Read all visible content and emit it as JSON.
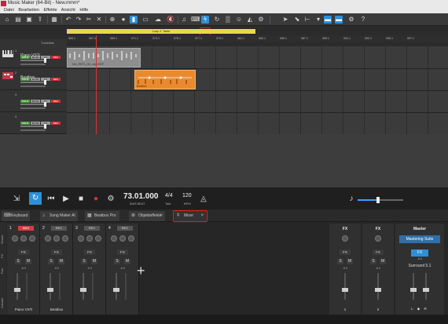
{
  "window": {
    "title": "Music Maker (64-Bit) - New.mmm*"
  },
  "menu": {
    "items": [
      "Datei",
      "Bearbeiten",
      "Effekte",
      "Ansicht",
      "Hilfe"
    ]
  },
  "ruler": {
    "loop_label": "Loop 1 Takte",
    "marks": [
      "065.1",
      "067.1",
      "069.1",
      "071.1",
      "073.1",
      "075.1",
      "077.1",
      "079.1",
      "081.1",
      "083.1",
      "085.1",
      "087.1",
      "089.1",
      "091.1",
      "093.1",
      "095.1",
      "097.1"
    ]
  },
  "tracks_header": {
    "label": "Trackliste"
  },
  "tracks": [
    {
      "num": "1",
      "name": "Piano VSTi",
      "solo": "SOLO",
      "mute": "MUTE",
      "fx": "FX",
      "rec": "REC"
    },
    {
      "num": "2",
      "name": "Beatbox",
      "solo": "SOLO",
      "mute": "MUTE",
      "fx": "FX",
      "rec": "REC"
    },
    {
      "num": "3",
      "name": "",
      "solo": "SOLO",
      "mute": "MUTE",
      "fx": "FX",
      "rec": "REC"
    },
    {
      "num": "4",
      "name": "",
      "solo": "SOLO",
      "mute": "MUTE",
      "fx": "FX",
      "rec": "REC"
    }
  ],
  "clips": {
    "piano_label": "Mio_REF1_Ob_mp3.HDP",
    "beat_label": "Beatbox"
  },
  "transport": {
    "position": "73.01.000",
    "position_label": "BAR.BEAT",
    "time_sig": "4/4",
    "time_sig_label": "Takt",
    "bpm": "120",
    "bpm_label": "BPM",
    "volume_level": 0.45
  },
  "tabs": [
    {
      "icon": "keyboard-icon",
      "label": "Keyboard"
    },
    {
      "icon": "music-note-icon",
      "label": "Song Maker AI"
    },
    {
      "icon": "beatbox-icon",
      "label": "Beatbox Pro"
    },
    {
      "icon": "object-effects-icon",
      "label": "Objekteffekte"
    },
    {
      "icon": "mixer-icon",
      "label": "Mixer"
    }
  ],
  "mixer": {
    "side_labels": [
      "Sends",
      "FX",
      "Pan",
      "Volume"
    ],
    "channels": [
      {
        "num": "1",
        "tag": "MIDI",
        "fx": "FX",
        "s": "S",
        "m": "M",
        "db": "-6.0",
        "name": "Piano VSTi"
      },
      {
        "num": "2",
        "tag": "REC",
        "fx": "FX",
        "s": "S",
        "m": "M",
        "db": "-6.0",
        "name": "Beatbox"
      },
      {
        "num": "3",
        "tag": "REC",
        "fx": "FX",
        "s": "S",
        "m": "M",
        "db": "-6.0",
        "name": ""
      },
      {
        "num": "4",
        "tag": "REC",
        "fx": "FX",
        "s": "S",
        "m": "M",
        "db": "-6.0",
        "name": ""
      }
    ],
    "add_channel": "+",
    "fx_busses": [
      {
        "title": "FX",
        "fx": "FX",
        "s": "S",
        "m": "M",
        "db": "-6.0",
        "name": "1"
      },
      {
        "title": "FX",
        "fx": "FX",
        "s": "S",
        "m": "M",
        "db": "-6.0",
        "name": "2"
      }
    ],
    "master": {
      "title": "Master",
      "suite": "Mastering Suite",
      "fx": "FX",
      "surround": "Surround 5.1",
      "lr": "L ◆ R",
      "db": "-6.0"
    }
  },
  "colors": {
    "accent": "#2f8fd6",
    "highlight": "#e02020",
    "clip_orange": "#e88b2f",
    "loop_yellow": "#e8d84a"
  }
}
